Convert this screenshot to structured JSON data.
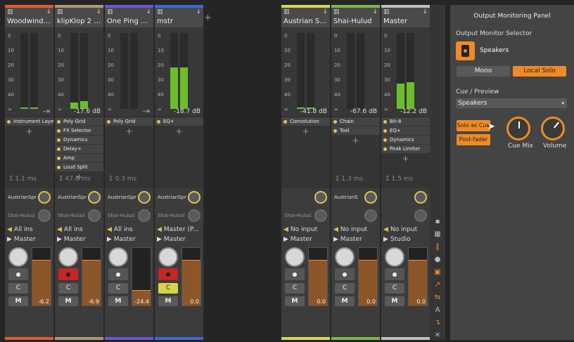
{
  "add_button": "+",
  "tracks": [
    {
      "name": "Woodwinds R...",
      "color": "#e25b2c",
      "db": "-∞",
      "fx": [
        "Instrument Layer"
      ],
      "time": "Σ 1.1 ms",
      "send1": "AustrianSpr",
      "send2": "Shai-Hulud",
      "input": "All ins",
      "output": "Master",
      "value": "-6.2"
    },
    {
      "name": "klipKlop 2 (wit...",
      "color": "#b09a72",
      "db": "-17.6 dB",
      "fx": [
        "Poly Grid",
        "FX Selector",
        "Dynamics",
        "Delay+",
        "Amp",
        "Loud Split"
      ],
      "time": "Σ 47.8 ms",
      "send1": "AustrianSpr",
      "send2": "Shai-Hulud",
      "input": "All ins",
      "output": "Master",
      "value": "-6.9"
    },
    {
      "name": "One Ping Only",
      "color": "#6a56d8",
      "db": "-∞",
      "fx": [
        "Poly Grid"
      ],
      "time": "Σ 0.3 ms",
      "send1": "AustrianSpr",
      "send2": "Shai-Hulud",
      "input": "All ins",
      "output": "Master",
      "value": "-24.4"
    },
    {
      "name": "mstr",
      "color": "#3a6ad8",
      "db": "-18.7 dB",
      "fx": [
        "EQ+"
      ],
      "time": "",
      "send1": "AustrianSpr",
      "send2": "Shai-Hulud",
      "input": "Master (P...",
      "output": "Master",
      "value": "0.0"
    },
    {
      "name": "Austrian Sprin...",
      "color": "#d8d84a",
      "db": "-41.8 dB",
      "fx": [
        "Convolution"
      ],
      "time": "",
      "send1": "",
      "send2": "Shai-Hulud",
      "input": "No input",
      "output": "Master",
      "value": "0.0"
    },
    {
      "name": "Shai-Hulud",
      "color": "#7ab84a",
      "db": "-67.6 dB",
      "fx": [
        "Chain",
        "Tool"
      ],
      "time": "Σ 1.3 ms",
      "send1": "AustrianS",
      "send2": "",
      "input": "No input",
      "output": "Master",
      "value": "0.0"
    },
    {
      "name": "Master",
      "color": "#c0c0c0",
      "db": "-12.2 dB",
      "fx": [
        "Bit-8",
        "EQ+",
        "Dynamics",
        "Peak Limiter"
      ],
      "time": "Σ 1.5 ms",
      "send1": "",
      "send2": "",
      "input": "No input",
      "output": "Studio",
      "value": "0.0"
    }
  ],
  "meter_labels": [
    "0",
    "10",
    "20",
    "30",
    "40",
    "∞"
  ],
  "buttons": {
    "cue": "C",
    "mute": "M"
  },
  "panel": {
    "title": "Output Monitoring Panel",
    "selector_label": "Output Monitor Selector",
    "speaker": "Speakers",
    "mono": "Mono",
    "local_solo": "Local Solo",
    "cue_label": "Cue / Preview",
    "cue_value": "Speakers",
    "solo_as_cue": "Solo as Cue",
    "post_fader": "Post-fader",
    "cue_mix": "Cue Mix",
    "volume": "Volume"
  }
}
